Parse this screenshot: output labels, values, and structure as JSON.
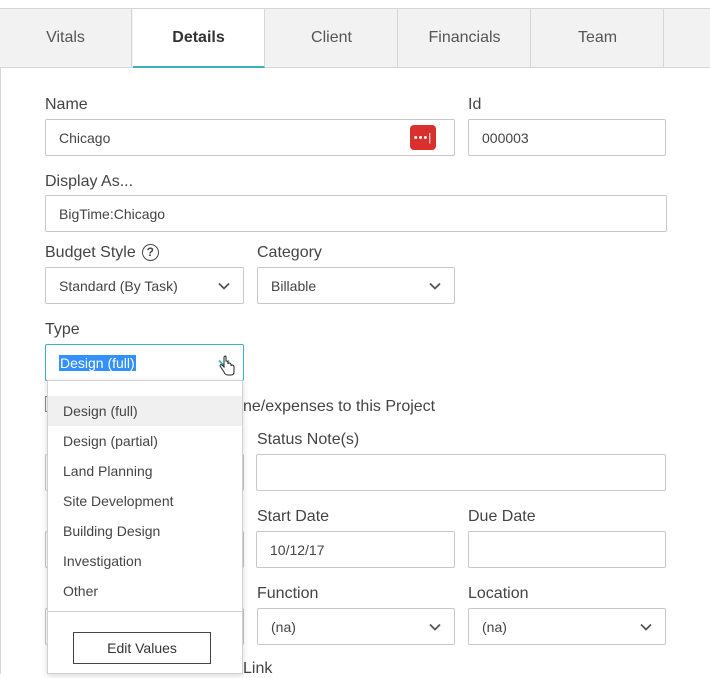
{
  "tabs": [
    "Vitals",
    "Details",
    "Client",
    "Financials",
    "Team"
  ],
  "form": {
    "name_label": "Name",
    "name_value": "Chicago",
    "id_label": "Id",
    "id_value": "000003",
    "display_label": "Display As...",
    "display_value": "BigTime:Chicago",
    "budget_label": "Budget Style",
    "budget_help": "?",
    "budget_value": "Standard (By Task)",
    "category_label": "Category",
    "category_value": "Billable",
    "type_label": "Type",
    "type_value": "Design (full)",
    "checkbox_text_partial": "ne/expenses to this Project",
    "status_note_label": "Status Note(s)",
    "status_note_value": "",
    "start_label": "Start Date",
    "start_value": "10/12/17",
    "due_label": "Due Date",
    "due_value": "",
    "function_label": "Function",
    "function_value": "(na)",
    "location_label": "Location",
    "location_value": "(na)",
    "link_label_partial": "Link"
  },
  "dropdown": {
    "options": [
      "Design (full)",
      "Design (partial)",
      "Land Planning",
      "Site Development",
      "Building Design",
      "Investigation",
      "Other"
    ],
    "edit_button": "Edit Values"
  },
  "colors": {
    "accent": "#3ab0c1",
    "lastpass": "#d9302e",
    "selection": "#3390ff"
  }
}
